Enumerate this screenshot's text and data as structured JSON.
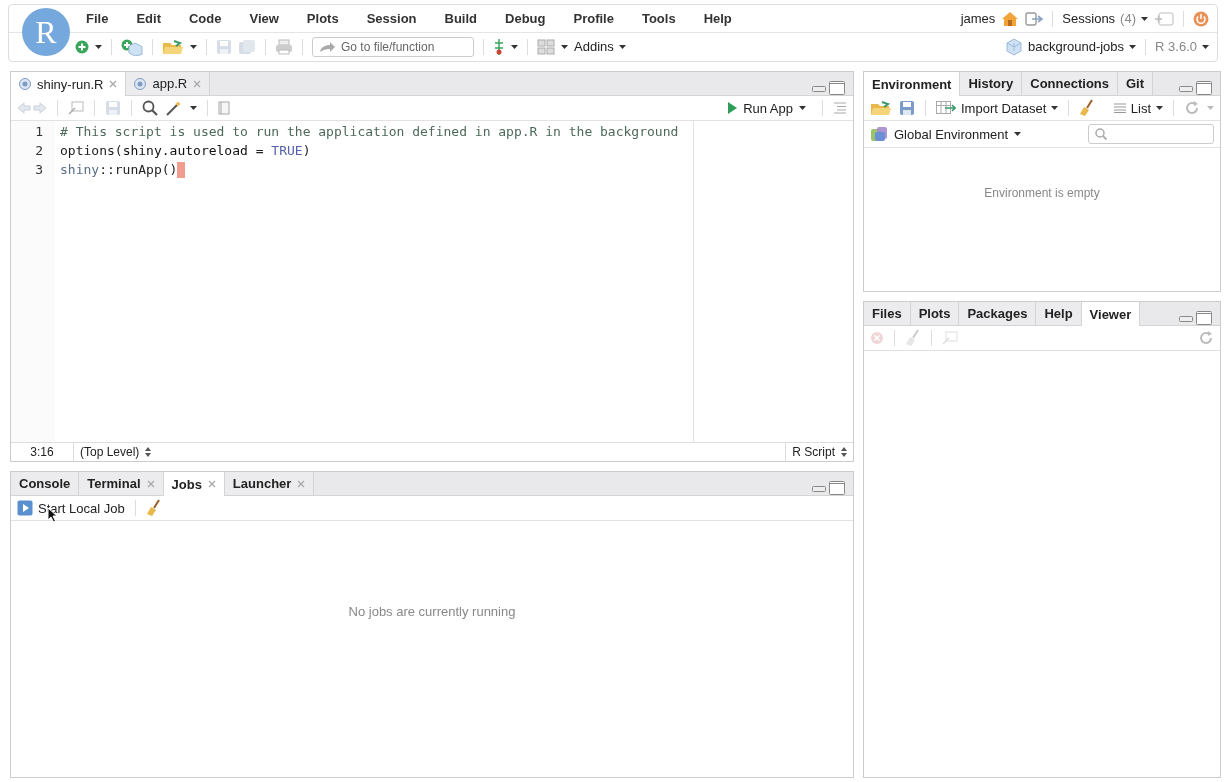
{
  "logo": "R",
  "menu": [
    "File",
    "Edit",
    "Code",
    "View",
    "Plots",
    "Session",
    "Build",
    "Debug",
    "Profile",
    "Tools",
    "Help"
  ],
  "user": "james",
  "sessions": {
    "label": "Sessions",
    "count": "(4)"
  },
  "toolbar": {
    "goto_placeholder": "Go to file/function",
    "addins": "Addins",
    "project": "background-jobs",
    "r_version": "R 3.6.0"
  },
  "editor": {
    "tabs": [
      {
        "label": "shiny-run.R",
        "selected": true,
        "closable": true
      },
      {
        "label": "app.R",
        "selected": false,
        "closable": true
      }
    ],
    "run_button": "Run App",
    "lines": [
      {
        "number": "1",
        "tokens": [
          {
            "kind": "comment",
            "text": "# This script is used to run the application defined in app.R in the background"
          }
        ]
      },
      {
        "number": "2",
        "tokens": [
          {
            "kind": "plain",
            "text": "options("
          },
          {
            "kind": "ident",
            "text": "shiny.autoreload"
          },
          {
            "kind": "plain",
            "text": " = "
          },
          {
            "kind": "keyword",
            "text": "TRUE"
          },
          {
            "kind": "plain",
            "text": ")"
          }
        ]
      },
      {
        "number": "3",
        "tokens": [
          {
            "kind": "namespace",
            "text": "shiny"
          },
          {
            "kind": "plain",
            "text": "::runApp("
          },
          {
            "kind": "plain",
            "text": ")"
          }
        ],
        "cursor": true
      }
    ],
    "status": {
      "position": "3:16",
      "scope": "(Top Level)",
      "file_type": "R Script"
    }
  },
  "console": {
    "tabs": [
      {
        "label": "Console",
        "selected": false,
        "closable": false
      },
      {
        "label": "Terminal",
        "selected": false,
        "closable": true
      },
      {
        "label": "Jobs",
        "selected": true,
        "closable": true
      },
      {
        "label": "Launcher",
        "selected": false,
        "closable": true
      }
    ],
    "start_button": "Start Local Job",
    "empty_message": "No jobs are currently running"
  },
  "environment": {
    "tabs": [
      {
        "label": "Environment",
        "selected": true
      },
      {
        "label": "History",
        "selected": false
      },
      {
        "label": "Connections",
        "selected": false
      },
      {
        "label": "Git",
        "selected": false
      }
    ],
    "import_button": "Import Dataset",
    "view_mode": "List",
    "scope": "Global Environment",
    "empty_message": "Environment is empty"
  },
  "viewer": {
    "tabs": [
      {
        "label": "Files",
        "selected": false
      },
      {
        "label": "Plots",
        "selected": false
      },
      {
        "label": "Packages",
        "selected": false
      },
      {
        "label": "Help",
        "selected": false
      },
      {
        "label": "Viewer",
        "selected": true
      }
    ]
  }
}
